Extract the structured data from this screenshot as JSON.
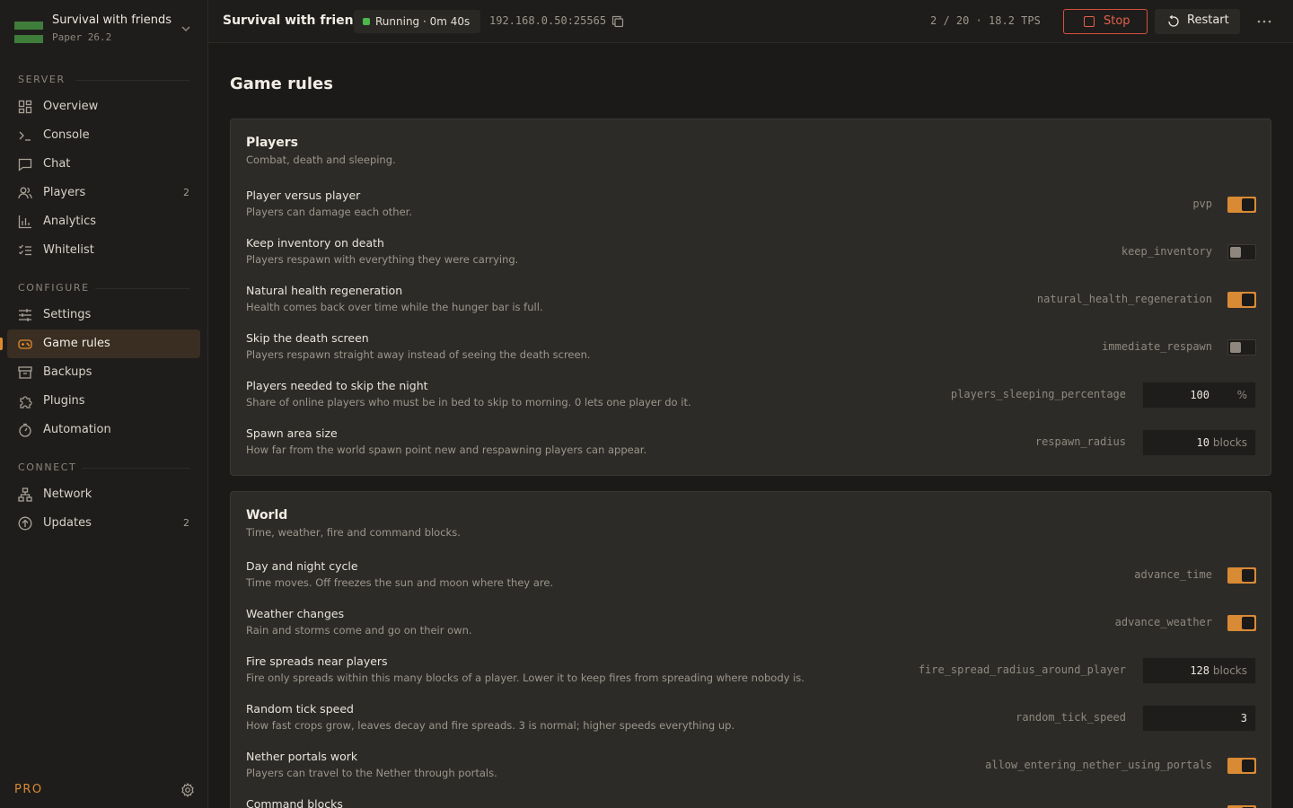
{
  "server": {
    "name": "Survival with friends",
    "version": "Paper 26.2"
  },
  "sidebar": {
    "sections": [
      {
        "label": "SERVER"
      },
      {
        "label": "CONFIGURE"
      },
      {
        "label": "CONNECT"
      }
    ],
    "items": [
      {
        "label": "Overview",
        "icon": "grid-icon"
      },
      {
        "label": "Console",
        "icon": "terminal-icon"
      },
      {
        "label": "Chat",
        "icon": "chat-icon"
      },
      {
        "label": "Players",
        "icon": "users-icon",
        "count": "2"
      },
      {
        "label": "Analytics",
        "icon": "bar-chart-icon"
      },
      {
        "label": "Whitelist",
        "icon": "checklist-icon"
      },
      {
        "label": "Settings",
        "icon": "sliders-icon"
      },
      {
        "label": "Game rules",
        "icon": "gamepad-icon",
        "active": true
      },
      {
        "label": "Backups",
        "icon": "archive-icon"
      },
      {
        "label": "Plugins",
        "icon": "puzzle-icon"
      },
      {
        "label": "Automation",
        "icon": "timer-icon"
      },
      {
        "label": "Network",
        "icon": "network-icon"
      },
      {
        "label": "Updates",
        "icon": "arrow-up-circle-icon",
        "count": "2"
      }
    ],
    "footer": {
      "plan": "PRO"
    }
  },
  "topbar": {
    "title": "Survival with friends",
    "status": "Running · 0m 40s",
    "address": "192.168.0.50:25565",
    "stats": "2 / 20 · 18.2 TPS",
    "stop_label": "Stop",
    "restart_label": "Restart"
  },
  "page": {
    "title": "Game rules"
  },
  "cards": [
    {
      "title": "Players",
      "subtitle": "Combat, death and sleeping.",
      "rules": [
        {
          "title": "Player versus player",
          "desc": "Players can damage each other.",
          "key": "pvp",
          "type": "toggle",
          "value": true
        },
        {
          "title": "Keep inventory on death",
          "desc": "Players respawn with everything they were carrying.",
          "key": "keep_inventory",
          "type": "toggle",
          "value": false
        },
        {
          "title": "Natural health regeneration",
          "desc": "Health comes back over time while the hunger bar is full.",
          "key": "natural_health_regeneration",
          "type": "toggle",
          "value": true
        },
        {
          "title": "Skip the death screen",
          "desc": "Players respawn straight away instead of seeing the death screen.",
          "key": "immediate_respawn",
          "type": "toggle",
          "value": false
        },
        {
          "title": "Players needed to skip the night",
          "desc": "Share of online players who must be in bed to skip to morning. 0 lets one player do it.",
          "key": "players_sleeping_percentage",
          "type": "number",
          "value": "100",
          "unit": "%"
        },
        {
          "title": "Spawn area size",
          "desc": "How far from the world spawn point new and respawning players can appear.",
          "key": "respawn_radius",
          "type": "number",
          "value": "10",
          "unit": "blocks"
        }
      ]
    },
    {
      "title": "World",
      "subtitle": "Time, weather, fire and command blocks.",
      "rules": [
        {
          "title": "Day and night cycle",
          "desc": "Time moves. Off freezes the sun and moon where they are.",
          "key": "advance_time",
          "type": "toggle",
          "value": true
        },
        {
          "title": "Weather changes",
          "desc": "Rain and storms come and go on their own.",
          "key": "advance_weather",
          "type": "toggle",
          "value": true
        },
        {
          "title": "Fire spreads near players",
          "desc": "Fire only spreads within this many blocks of a player. Lower it to keep fires from spreading where nobody is.",
          "key": "fire_spread_radius_around_player",
          "type": "number",
          "value": "128",
          "unit": "blocks"
        },
        {
          "title": "Random tick speed",
          "desc": "How fast crops grow, leaves decay and fire spreads. 3 is normal; higher speeds everything up.",
          "key": "random_tick_speed",
          "type": "number",
          "value": "3",
          "unit": ""
        },
        {
          "title": "Nether portals work",
          "desc": "Players can travel to the Nether through portals.",
          "key": "allow_entering_nether_using_portals",
          "type": "toggle",
          "value": true
        },
        {
          "title": "Command blocks",
          "desc": "",
          "key": "",
          "type": "toggle",
          "value": true
        }
      ]
    }
  ]
}
